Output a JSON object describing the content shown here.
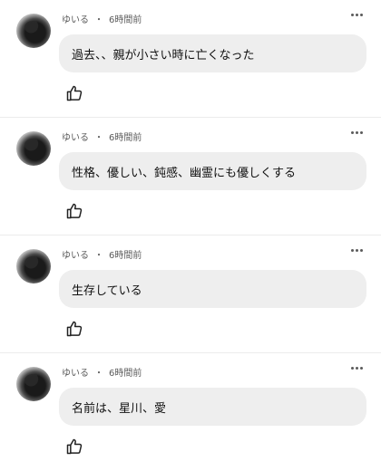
{
  "comments": [
    {
      "author": "ゆいる",
      "separator": "・",
      "time": "6時間前",
      "text": "過去、、親が小さい時に亡くなった"
    },
    {
      "author": "ゆいる",
      "separator": "・",
      "time": "6時間前",
      "text": "性格、優しい、鈍感、幽霊にも優しくする"
    },
    {
      "author": "ゆいる",
      "separator": "・",
      "time": "6時間前",
      "text": "生存している"
    },
    {
      "author": "ゆいる",
      "separator": "・",
      "time": "6時間前",
      "text": "名前は、星川、愛"
    }
  ]
}
